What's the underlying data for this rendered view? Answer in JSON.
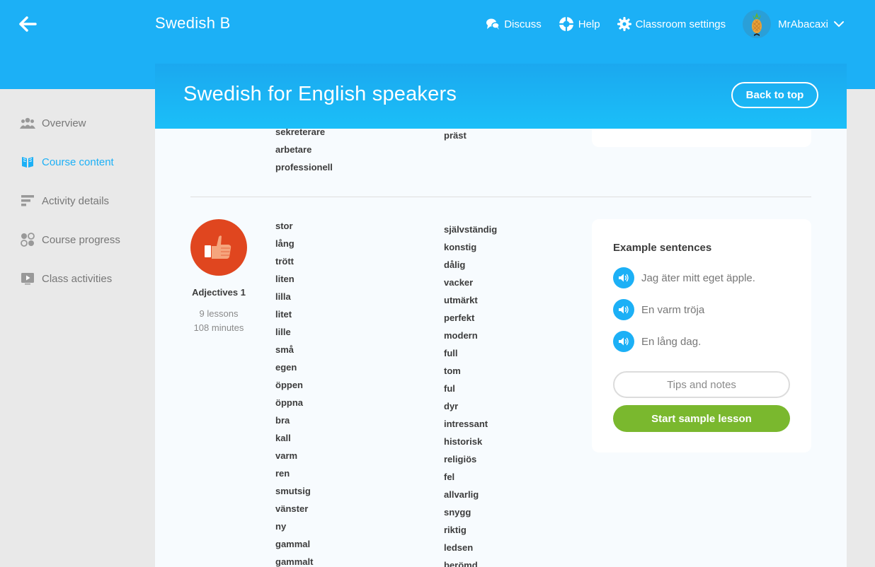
{
  "header": {
    "back_icon": "arrow-left-icon",
    "course_name": "Swedish B",
    "nav": [
      {
        "label": "Discuss",
        "icon": "chat-bubbles-icon"
      },
      {
        "label": "Help",
        "icon": "lifebuoy-icon"
      },
      {
        "label": "Classroom settings",
        "icon": "gear-icon"
      }
    ],
    "user": {
      "name": "MrAbacaxi",
      "icon": "chevron-down-icon"
    }
  },
  "sidebar": {
    "items": [
      {
        "label": "Overview",
        "icon": "people-icon",
        "active": false
      },
      {
        "label": "Course content",
        "icon": "book-icon",
        "active": true
      },
      {
        "label": "Activity details",
        "icon": "bars-icon",
        "active": false
      },
      {
        "label": "Course progress",
        "icon": "circles-icon",
        "active": false
      },
      {
        "label": "Class activities",
        "icon": "video-icon",
        "active": false
      }
    ]
  },
  "panel": {
    "title": "Swedish for English speakers",
    "back_to_top": "Back to top"
  },
  "previous_skill": {
    "words_left": [
      "sekreterare",
      "arbetare",
      "professionell"
    ],
    "words_right": [
      "präst"
    ]
  },
  "skill": {
    "name": "Adjectives 1",
    "lessons": "9 lessons",
    "minutes": "108 minutes",
    "icon": "thumbs-up-icon",
    "color": "#e0461f",
    "words_left": [
      "stor",
      "lång",
      "trött",
      "liten",
      "lilla",
      "litet",
      "lille",
      "små",
      "egen",
      "öppen",
      "öppna",
      "bra",
      "kall",
      "varm",
      "ren",
      "smutsig",
      "vänster",
      "ny",
      "gammal",
      "gammalt"
    ],
    "words_right": [
      "självständig",
      "konstig",
      "dålig",
      "vacker",
      "utmärkt",
      "perfekt",
      "modern",
      "full",
      "tom",
      "ful",
      "dyr",
      "intressant",
      "historisk",
      "religiös",
      "fel",
      "allvarlig",
      "snygg",
      "riktig",
      "ledsen",
      "berömd"
    ],
    "examples_title": "Example sentences",
    "examples": [
      "Jag äter mitt eget äpple.",
      "En varm tröja",
      "En lång dag."
    ],
    "tips_label": "Tips and notes",
    "start_label": "Start sample lesson"
  },
  "colors": {
    "brand_blue": "#1cb0f6",
    "start_green": "#7ab82e",
    "skill_red": "#e0461f"
  }
}
